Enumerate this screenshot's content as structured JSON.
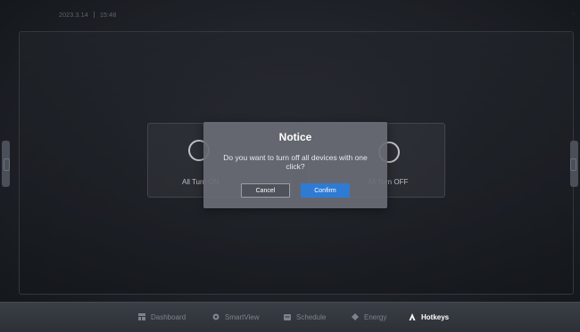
{
  "status": {
    "date": "2023.3.14",
    "time": "15:48",
    "right_mark": "·"
  },
  "cards": [
    {
      "label": "All Turn ON"
    },
    {
      "label": "All Turn OFF"
    }
  ],
  "dialog": {
    "title": "Notice",
    "message": "Do you want to turn off all devices with one click?",
    "cancel_label": "Cancel",
    "confirm_label": "Confirm"
  },
  "nav": {
    "items": [
      {
        "label": "Dashboard",
        "icon": "dashboard-icon"
      },
      {
        "label": "SmartView",
        "icon": "smartview-icon"
      },
      {
        "label": "Schedule",
        "icon": "schedule-icon"
      },
      {
        "label": "Energy",
        "icon": "energy-icon"
      },
      {
        "label": "Hotkeys",
        "icon": "hotkeys-icon",
        "active": true
      }
    ]
  },
  "colors": {
    "accent": "#2f7bd4",
    "dialog_bg": "#686c74",
    "background": "#1b1f26"
  }
}
